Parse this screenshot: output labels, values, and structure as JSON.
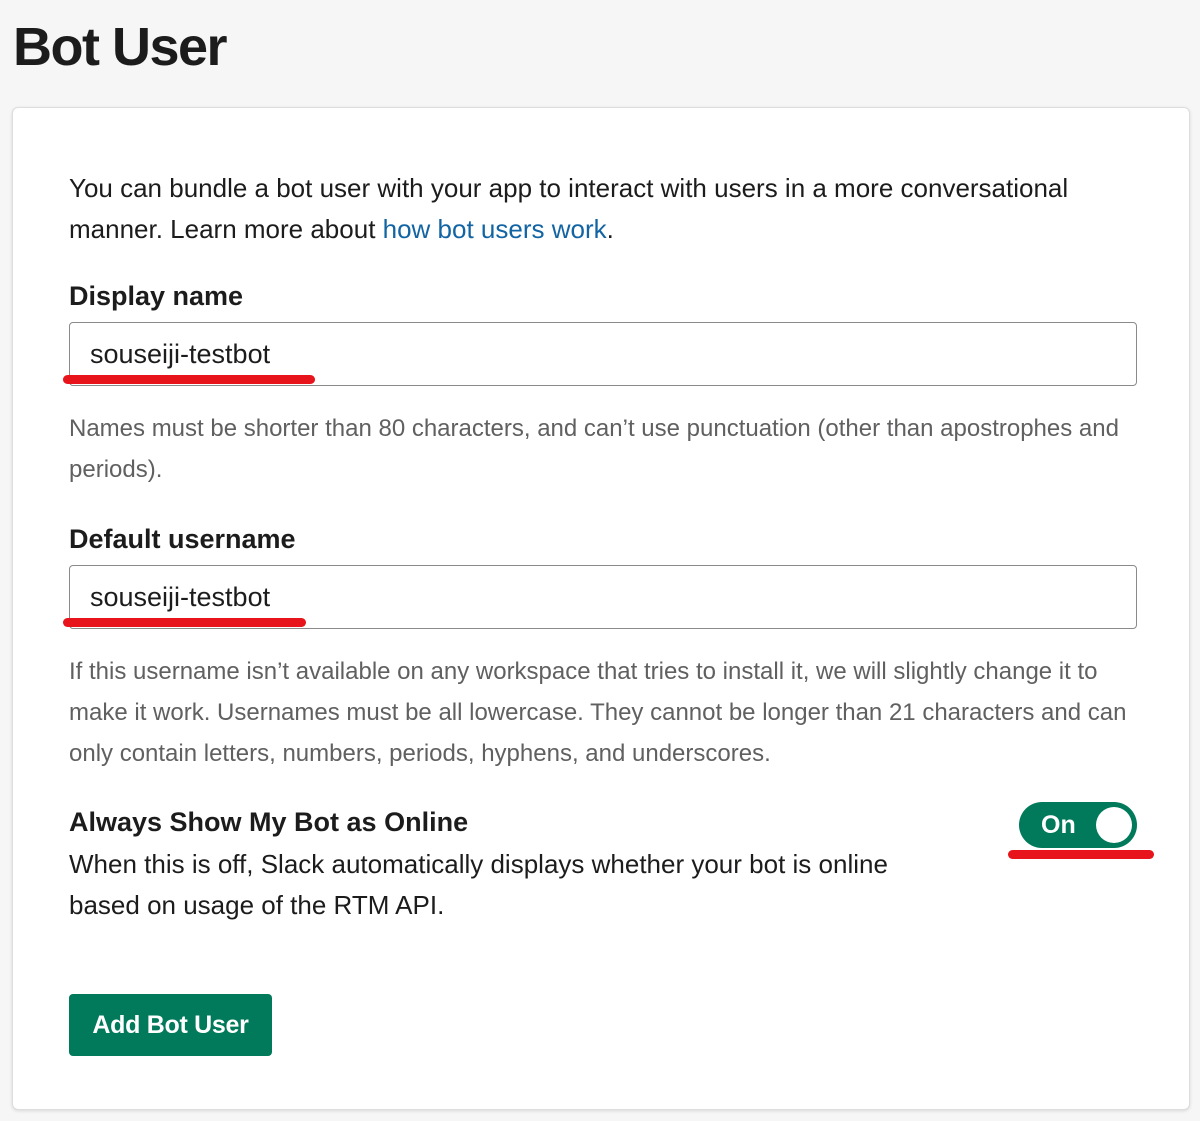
{
  "page": {
    "title": "Bot User"
  },
  "intro": {
    "text": "You can bundle a bot user with your app to interact with users in a more conversational manner. Learn more about ",
    "link_text": "how bot users work",
    "suffix": "."
  },
  "display_name": {
    "label": "Display name",
    "value": "souseiji-testbot",
    "hint": "Names must be shorter than 80 characters, and can’t use punctuation (other than apostrophes and periods)."
  },
  "default_username": {
    "label": "Default username",
    "value": "souseiji-testbot",
    "hint": "If this username isn’t available on any workspace that tries to install it, we will slightly change it to make it work. Usernames must be all lowercase. They cannot be longer than 21 characters and can only contain letters, numbers, periods, hyphens, and underscores."
  },
  "online_toggle": {
    "title": "Always Show My Bot as Online",
    "description": "When this is off, Slack automatically displays whether your bot is online based on usage of the RTM API.",
    "state_label": "On"
  },
  "actions": {
    "add_label": "Add Bot User"
  },
  "colors": {
    "accent_green": "#007a5a",
    "link_blue": "#1264a3",
    "annotation_red": "#e8141c"
  }
}
